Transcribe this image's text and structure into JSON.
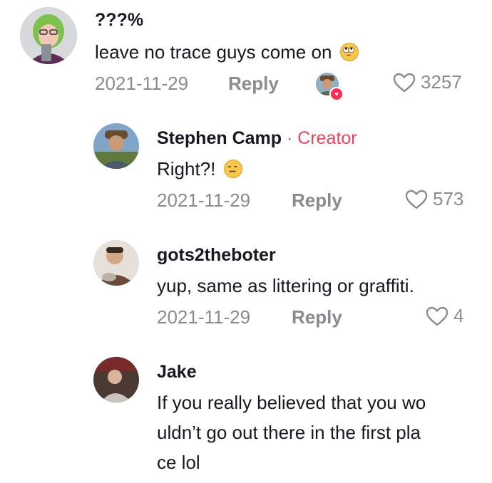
{
  "comments": [
    {
      "username": "???%",
      "text": "leave no trace guys come on",
      "emoji": "rolling-eyes",
      "date": "2021-11-29",
      "reply_label": "Reply",
      "likes": "3257",
      "creator_liked": true
    },
    {
      "username": "Stephen Camp",
      "badge_separator": "·",
      "badge": "Creator",
      "text": "Right?!",
      "emoji": "expressionless",
      "date": "2021-11-29",
      "reply_label": "Reply",
      "likes": "573"
    },
    {
      "username": "gots2theboter",
      "text": "yup, same as littering or graffiti.",
      "date": "2021-11-29",
      "reply_label": "Reply",
      "likes": "4"
    },
    {
      "username": "Jake",
      "text_lines": [
        "If you really believed that you wo",
        "uldn’t go out there in the first pla",
        "ce lol"
      ]
    }
  ],
  "colors": {
    "creator_badge": "#e8445a",
    "meta_gray": "#8a8b91",
    "text": "#161823",
    "like_heart_red": "#fe2c55"
  },
  "icons": {
    "like": "heart-outline-icon",
    "creator_like": "heart-filled-icon"
  }
}
